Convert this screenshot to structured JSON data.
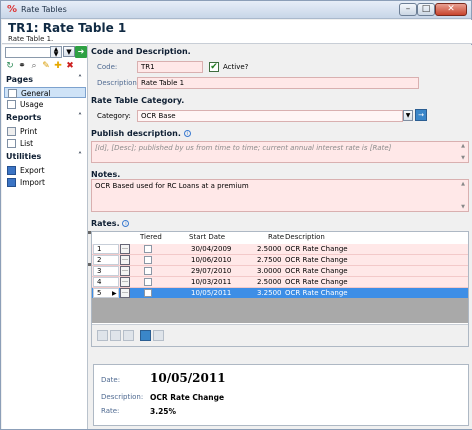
{
  "window": {
    "title": "Rate Tables",
    "app_icon": "percent-icon"
  },
  "header": {
    "title": "TR1: Rate Table 1",
    "subtitle": "Rate Table 1."
  },
  "sidebar": {
    "sections": [
      {
        "title": "Pages",
        "items": [
          "General",
          "Usage"
        ],
        "selected": "General"
      },
      {
        "title": "Reports",
        "items": [
          "Print",
          "List"
        ]
      },
      {
        "title": "Utilities",
        "items": [
          "Export",
          "Import"
        ]
      }
    ],
    "collapse_glyph": "˄"
  },
  "code_description": {
    "section_title": "Code and Description.",
    "code_label": "Code:",
    "code_value": "TR1",
    "active_label": "Active?",
    "description_label": "Description:",
    "description_value": "Rate Table 1"
  },
  "category": {
    "section_title": "Rate Table Category.",
    "label": "Category:",
    "value": "OCR Base"
  },
  "publish": {
    "section_title": "Publish description.",
    "value": "[Id], [Desc]; published by us from time to time; current annual interest rate is [Rate]"
  },
  "notes": {
    "section_title": "Notes.",
    "value": "OCR Based used for RC Loans at a premium"
  },
  "rates": {
    "section_title": "Rates.",
    "columns": [
      "Tiered",
      "Start Date",
      "Rate",
      "Description"
    ],
    "rows": [
      {
        "num": "1",
        "start_date": "30/04/2009",
        "rate": "2.5000",
        "description": "OCR Rate Change"
      },
      {
        "num": "2",
        "start_date": "10/06/2010",
        "rate": "2.7500",
        "description": "OCR Rate Change"
      },
      {
        "num": "3",
        "start_date": "29/07/2010",
        "rate": "3.0000",
        "description": "OCR Rate Change"
      },
      {
        "num": "4",
        "start_date": "10/03/2011",
        "rate": "2.5000",
        "description": "OCR Rate Change"
      },
      {
        "num": "5",
        "start_date": "10/05/2011",
        "rate": "3.2500",
        "description": "OCR Rate Change"
      }
    ],
    "selected_row": 4
  },
  "detail": {
    "date_label": "Date:",
    "date_value": "10/05/2011",
    "description_label": "Description:",
    "description_value": "OCR Rate Change",
    "rate_label": "Rate:",
    "rate_value": "3.25%"
  },
  "colors": {
    "required_bg": "#ffe8e8",
    "selected_row": "#3d8ee6",
    "label_blue": "#4f6a91"
  }
}
